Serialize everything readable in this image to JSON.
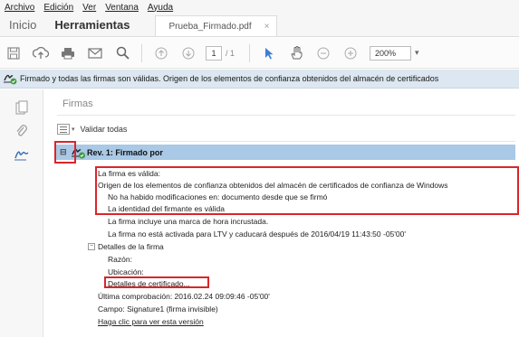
{
  "menu": [
    "Archivo",
    "Edición",
    "Ver",
    "Ventana",
    "Ayuda"
  ],
  "tabs": {
    "home": "Inicio",
    "tools": "Herramientas",
    "doc": "Prueba_Firmado.pdf",
    "close": "×"
  },
  "toolbar": {
    "icons": [
      "save-icon",
      "upload-icon",
      "print-icon",
      "mail-icon",
      "search-icon",
      "prev-page-icon",
      "next-page-icon",
      "select-arrow-icon",
      "hand-icon",
      "zoom-out-icon",
      "zoom-in-icon"
    ],
    "page_current": "1",
    "page_total": "/ 1",
    "zoom": "200%",
    "zoom_caret": "▾"
  },
  "status": {
    "text": "Firmado y todas las firmas son válidas. Origen de los elementos de confianza obtenidos del almacén de certificados"
  },
  "panel": {
    "title": "Firmas",
    "validate_all": "Validar todas",
    "signature_title": "Rev. 1: Firmado por",
    "lines": {
      "valid": "La firma es válida:",
      "origin": "Origen de los elementos de confianza obtenidos del almacén de certificados de confianza de Windows",
      "no_changes": "No ha habido modificaciones en: documento desde que se firmó",
      "identity": "La identidad del firmante es válida",
      "timestamp": "La firma incluye una marca de hora incrustada.",
      "ltv": "La firma no está activada para LTV y caducará después de 2016/04/19 11:43:50 -05'00'",
      "details": "Detalles de la firma",
      "reason": "Razón:",
      "location": "Ubicación:",
      "cert_details": "Detalles de certificado...",
      "last_check": "Última comprobación: 2016.02.24 09:09:46 -05'00'",
      "field": "Campo: Signature1 (firma invisible)",
      "view_version": "Haga clic para ver esta versión"
    }
  },
  "colors": {
    "highlight": "#a9c9e6",
    "status_bg": "#dce7f1",
    "annotation": "#d9262b"
  }
}
